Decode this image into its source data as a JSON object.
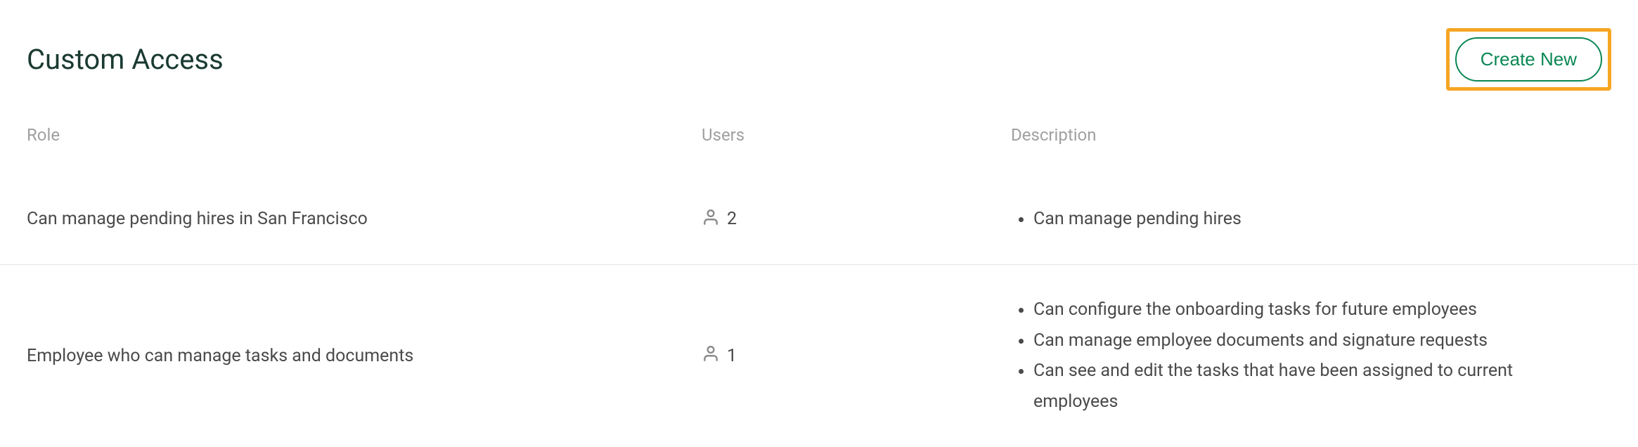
{
  "header": {
    "title": "Custom Access",
    "create_new_label": "Create New"
  },
  "table": {
    "columns": {
      "role": "Role",
      "users": "Users",
      "description": "Description"
    },
    "rows": [
      {
        "role": "Can manage pending hires in San Francisco",
        "user_count": "2",
        "descriptions": [
          "Can manage pending hires"
        ]
      },
      {
        "role": "Employee who can manage tasks and documents",
        "user_count": "1",
        "descriptions": [
          "Can configure the onboarding tasks for future employees",
          "Can manage employee documents and signature requests",
          "Can see and edit the tasks that have been assigned to current employees"
        ]
      }
    ]
  },
  "colors": {
    "accent": "#0a8754",
    "highlight": "#f5a623",
    "text_dark": "#1a3a32",
    "text_body": "#4a4a4a",
    "text_muted": "#a0a0a0"
  }
}
